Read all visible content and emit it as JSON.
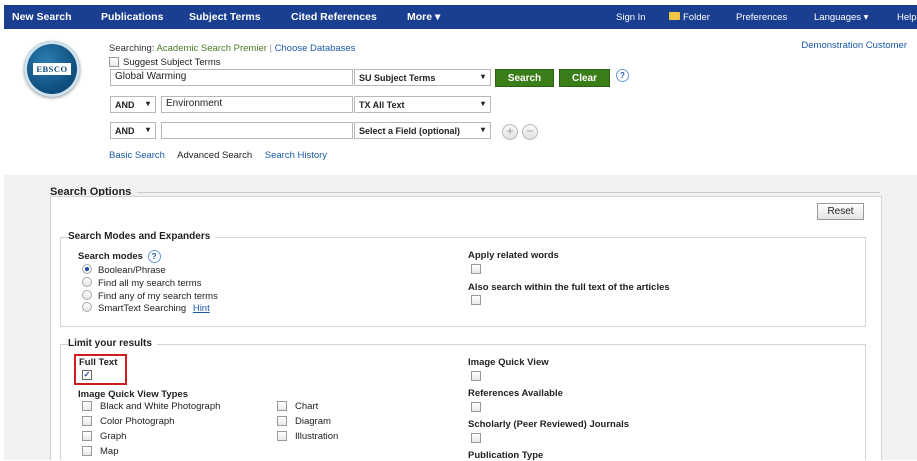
{
  "nav": {
    "new_search": "New Search",
    "publications": "Publications",
    "subject_terms": "Subject Terms",
    "cited_references": "Cited References",
    "more": "More ▾",
    "sign_in": "Sign In",
    "folder": "Folder",
    "preferences": "Preferences",
    "languages": "Languages ▾",
    "help": "Help"
  },
  "header": {
    "logo_text": "EBSCO",
    "searching_label": "Searching:",
    "database": "Academic Search Premier",
    "separator": "|",
    "choose_databases": "Choose Databases",
    "suggest_subject_terms": "Suggest Subject Terms",
    "customer": "Demonstration Customer"
  },
  "search": {
    "row1": {
      "value": "Global Warming",
      "field": "SU Subject Terms"
    },
    "row2": {
      "operator": "AND",
      "value": "Environment",
      "field": "TX All Text"
    },
    "row3": {
      "operator": "AND",
      "value": "",
      "field": "Select a Field (optional)"
    },
    "search_button": "Search",
    "clear_button": "Clear",
    "help_glyph": "?",
    "add_glyph": "+",
    "remove_glyph": "−"
  },
  "tabs": {
    "basic": "Basic Search",
    "advanced": "Advanced Search",
    "history": "Search History"
  },
  "options": {
    "title": "Search Options",
    "reset": "Reset",
    "modes_title": "Search Modes and Expanders",
    "search_modes_label": "Search modes",
    "modes": [
      "Boolean/Phrase",
      "Find all my search terms",
      "Find any of my search terms",
      "SmartText Searching"
    ],
    "hint": "Hint",
    "apply_related": "Apply related words",
    "also_search": "Also search within the full text of the articles",
    "limit_title": "Limit your results",
    "full_text": "Full Text",
    "image_quick_view_types": "Image Quick View Types",
    "iqv_types_left": [
      "Black and White Photograph",
      "Color Photograph",
      "Graph",
      "Map"
    ],
    "iqv_types_right": [
      "Chart",
      "Diagram",
      "Illustration"
    ],
    "image_quick_view": "Image Quick View",
    "references_available": "References Available",
    "scholarly": "Scholarly (Peer Reviewed) Journals",
    "publication_type": "Publication Type"
  }
}
